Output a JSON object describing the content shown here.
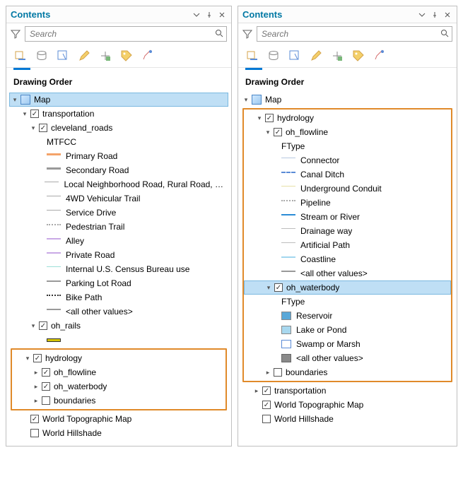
{
  "shared": {
    "title": "Contents",
    "search_placeholder": "Search",
    "section": "Drawing Order",
    "map_label": "Map",
    "world_topo": "World Topographic Map",
    "world_hill": "World Hillshade"
  },
  "left": {
    "transportation": "transportation",
    "cleveland_roads": "cleveland_roads",
    "mtfcc": "MTFCC",
    "roads": [
      "Primary Road",
      "Secondary Road",
      "Local Neighborhood Road, Rural Road, City...",
      "4WD Vehicular Trail",
      "Service Drive",
      "Pedestrian Trail",
      "Alley",
      "Private Road",
      "Internal U.S. Census Bureau use",
      "Parking Lot Road",
      "Bike Path"
    ],
    "road_colors": [
      {
        "type": "solid",
        "color": "#f4a36a",
        "w": 3
      },
      {
        "type": "solid",
        "color": "#999",
        "w": 3
      },
      {
        "type": "solid",
        "color": "#aaa",
        "w": 1
      },
      {
        "type": "solid",
        "color": "#aaa",
        "w": 1
      },
      {
        "type": "solid",
        "color": "#aaa",
        "w": 1
      },
      {
        "type": "dot",
        "color": "#aaa"
      },
      {
        "type": "solid",
        "color": "#c9a9e6",
        "w": 2
      },
      {
        "type": "solid",
        "color": "#c9a9e6",
        "w": 2
      },
      {
        "type": "solid",
        "color": "#9de0d8",
        "w": 1
      },
      {
        "type": "solid",
        "color": "#999",
        "w": 2
      },
      {
        "type": "dot",
        "color": "#333"
      }
    ],
    "all_other": "<all other values>",
    "oh_rails": "oh_rails",
    "hydrology": "hydrology",
    "oh_flowline": "oh_flowline",
    "oh_waterbody": "oh_waterbody",
    "boundaries": "boundaries"
  },
  "right": {
    "hydrology": "hydrology",
    "oh_flowline": "oh_flowline",
    "ftype1": "FType",
    "flow_items": [
      "Connector",
      "Canal Ditch",
      "Underground Conduit",
      "Pipeline",
      "Stream or River",
      "Drainage way",
      "Artificial Path",
      "Coastline"
    ],
    "flow_styles": [
      {
        "type": "solid",
        "color": "#b7c8e0",
        "w": 1
      },
      {
        "type": "dash",
        "color": "#5a8bd6"
      },
      {
        "type": "solid",
        "color": "#e8e0a6",
        "w": 1
      },
      {
        "type": "dot",
        "color": "#aaa"
      },
      {
        "type": "solid",
        "color": "#2b8cd6",
        "w": 2
      },
      {
        "type": "solid",
        "color": "#bdbdbd",
        "w": 1
      },
      {
        "type": "solid",
        "color": "#bdbdbd",
        "w": 1
      },
      {
        "type": "solid",
        "color": "#a2d7ef",
        "w": 2
      }
    ],
    "all_other": "<all other values>",
    "oh_waterbody": "oh_waterbody",
    "ftype2": "FType",
    "wb_items": [
      "Reservoir",
      "Lake or Pond",
      "Swamp or Marsh"
    ],
    "wb_colors": [
      "#5aa8d8",
      "#a8d8ef",
      "#ffffff"
    ],
    "wb_all_other_color": "#8a8a8a",
    "boundaries": "boundaries",
    "transportation": "transportation"
  },
  "chart_data": {
    "type": "table",
    "note": "Two Contents panels from ArcGIS Pro showing layer tree before/after expanding hydrology group",
    "left_panel_layers": {
      "Map": {
        "transportation": {
          "checked": true,
          "cleveland_roads": {
            "checked": true,
            "symbology_field": "MTFCC",
            "classes": [
              "Primary Road",
              "Secondary Road",
              "Local Neighborhood Road, Rural Road, City...",
              "4WD Vehicular Trail",
              "Service Drive",
              "Pedestrian Trail",
              "Alley",
              "Private Road",
              "Internal U.S. Census Bureau use",
              "Parking Lot Road",
              "Bike Path",
              "<all other values>"
            ]
          },
          "oh_rails": {
            "checked": true
          }
        },
        "hydrology_highlighted": {
          "checked": true,
          "oh_flowline": {
            "checked": true
          },
          "oh_waterbody": {
            "checked": true
          },
          "boundaries": {
            "checked": false
          }
        },
        "World Topographic Map": {
          "checked": true
        },
        "World Hillshade": {
          "checked": false
        }
      }
    },
    "right_panel_layers": {
      "Map": {
        "hydrology_highlighted": {
          "checked": true,
          "oh_flowline": {
            "checked": true,
            "symbology_field": "FType",
            "classes": [
              "Connector",
              "Canal Ditch",
              "Underground Conduit",
              "Pipeline",
              "Stream or River",
              "Drainage way",
              "Artificial Path",
              "Coastline",
              "<all other values>"
            ]
          },
          "oh_waterbody_selected": {
            "checked": true,
            "symbology_field": "FType",
            "classes": [
              "Reservoir",
              "Lake or Pond",
              "Swamp or Marsh",
              "<all other values>"
            ]
          },
          "boundaries": {
            "checked": false
          }
        },
        "transportation": {
          "checked": true
        },
        "World Topographic Map": {
          "checked": true
        },
        "World Hillshade": {
          "checked": false
        }
      }
    }
  }
}
